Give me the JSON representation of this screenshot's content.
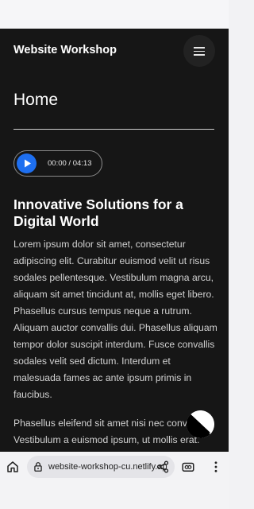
{
  "site": {
    "title": "Website Workshop"
  },
  "page": {
    "heading": "Home"
  },
  "player": {
    "current_time": "00:00",
    "separator": "/",
    "duration": "04:13"
  },
  "article": {
    "heading": "Innovative Solutions for a Digital World",
    "paragraph1": "Lorem ipsum dolor sit amet, consectetur adipiscing elit. Curabitur euismod velit ut risus sodales pellentesque. Vestibulum magna arcu, aliquam sit amet tincidunt at, mollis eget libero. Phasellus cursus tempus neque a rutrum. Aliquam auctor convallis dui. Phasellus aliquam tempor dolor suscipit interdum. Fusce convallis sodales velit sed dictum. Interdum et malesuada fames ac ante ipsum primis in faucibus.",
    "paragraph2_line1": "Phasellus eleifend sit amet nisi nec conv",
    "paragraph2_line2": "Vestibulum a euismod ipsum, ut mollis erat."
  },
  "browser": {
    "url": "website-workshop-cu.netlify.app"
  },
  "colors": {
    "page_bg": "#161616",
    "accent": "#1e6ff0",
    "browser_bar": "#f3f3f5"
  },
  "icons": [
    "menu-icon",
    "play-icon",
    "contrast-icon",
    "home-icon",
    "lock-icon",
    "share-icon",
    "tabs-icon",
    "more-vert-icon"
  ]
}
